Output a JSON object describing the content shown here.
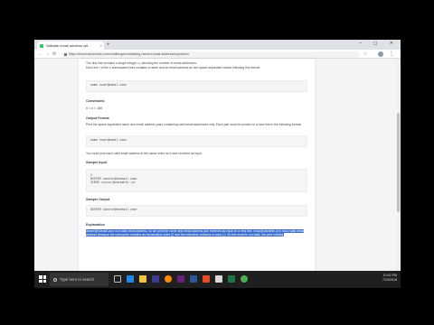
{
  "browser": {
    "tab_title": "Validate email address wit...",
    "tab_close": "×",
    "new_tab": "+",
    "window_controls": "–  ◻  ✕",
    "nav_back": "←",
    "nav_forward": "→",
    "nav_reload": "⟳",
    "url": "https://www.hackerrank.com/challenges/validating-named-email-addresses/problem",
    "star": "☆",
    "menu": "⋮"
  },
  "problem": {
    "intro_1": "The first line contains a single integer, n, denoting the number of email addresses.",
    "intro_2": "Each line i of the n subsequent lines contains a name and an email address as two space-separated values following this format:",
    "input_format_code": "name <user@email.com>",
    "constraints_heading": "Constraints",
    "constraints_value": "0 < n < 100",
    "output_format_heading": "Output Format",
    "output_format_text": "Print the space-separated name and email address pairs containing valid email addresses only. Each pair must be printed on a new line in the following format:",
    "output_format_code": "name <user@email.com>",
    "output_format_note": "You must print each valid email address in the same order as it was received as input.",
    "sample_input_heading": "Sample Input",
    "sample_input_lines": [
      "2",
      "DEXTER <dexter@hotmail.com>",
      "VIRUS <virus!@variable.:p>"
    ],
    "sample_output_heading": "Sample Output",
    "sample_output_code": "DEXTER <dexter@hotmail.com>",
    "explanation_heading": "Explanation",
    "explanation_text": "dexter@hotmail.com is a valid email address, so we print the name and email address pair received as input on a new line. virus!@variable.:p is not a valid email address because the username contains an exclamation point (!) and the extension contains a colon (:). As this email is not valid, we print nothing."
  },
  "taskbar": {
    "search_placeholder": "Type here to search",
    "time": "10:52 PM",
    "date": "7/23/2018"
  },
  "colors": {
    "selection": "#3c6fd0",
    "hackerrank_green": "#2ec866"
  }
}
